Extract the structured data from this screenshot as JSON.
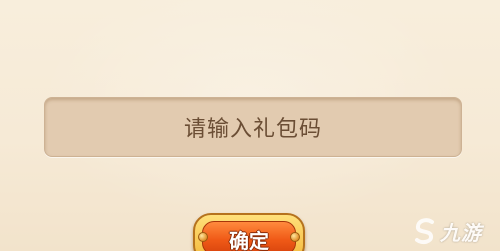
{
  "gift_code": {
    "placeholder": "请输入礼包码",
    "value": ""
  },
  "confirm_button": {
    "label": "确定"
  },
  "watermark": {
    "text": "九游",
    "icon": "jiuyou-logo-icon"
  },
  "colors": {
    "background": "#f6ead6",
    "input_fill": "#e2cbb0",
    "input_text": "#6b4e35",
    "button_orange": "#f05a17",
    "button_gold_border": "#f4b73a"
  }
}
